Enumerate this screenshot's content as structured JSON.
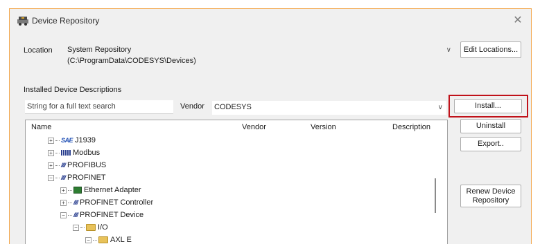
{
  "window": {
    "title": "Device Repository",
    "close_glyph": "✕"
  },
  "location": {
    "label": "Location",
    "value_name": "System Repository",
    "value_path": "(C:\\ProgramData\\CODESYS\\Devices)",
    "edit_button": "Edit Locations..."
  },
  "installed": {
    "group_label": "Installed Device Descriptions",
    "search_placeholder": "String for a full text search",
    "vendor_label": "Vendor",
    "vendor_value": "CODESYS"
  },
  "table": {
    "columns": [
      "Name",
      "Vendor",
      "Version",
      "Description"
    ],
    "rows": [
      {
        "label": "J1939",
        "icon": "sae-icon",
        "icon_text": "SAE",
        "expander": "+"
      },
      {
        "label": "Modbus",
        "icon": "modbus-icon",
        "expander": "+"
      },
      {
        "label": "PROFIBUS",
        "icon": "profibus-icon",
        "icon_text": "////",
        "expander": "+"
      },
      {
        "label": "PROFINET",
        "icon": "profinet-icon",
        "icon_text": "////",
        "expander": "−"
      },
      {
        "label": "Ethernet Adapter",
        "icon": "ethernet-adapter-icon",
        "expander": "+"
      },
      {
        "label": "PROFINET Controller",
        "icon": "profinet-icon",
        "icon_text": "////",
        "expander": "+"
      },
      {
        "label": "PROFINET Device",
        "icon": "profinet-icon",
        "icon_text": "////",
        "expander": "−"
      },
      {
        "label": "I/O",
        "icon": "folder-icon",
        "expander": "−"
      },
      {
        "label": "AXL E",
        "icon": "folder-icon",
        "expander": "−"
      }
    ]
  },
  "buttons": {
    "install": "Install...",
    "uninstall": "Uninstall",
    "export": "Export..",
    "renew": "Renew Device Repository"
  },
  "colors": {
    "highlight_border": "#c0121a",
    "window_border": "#f3a64a"
  }
}
